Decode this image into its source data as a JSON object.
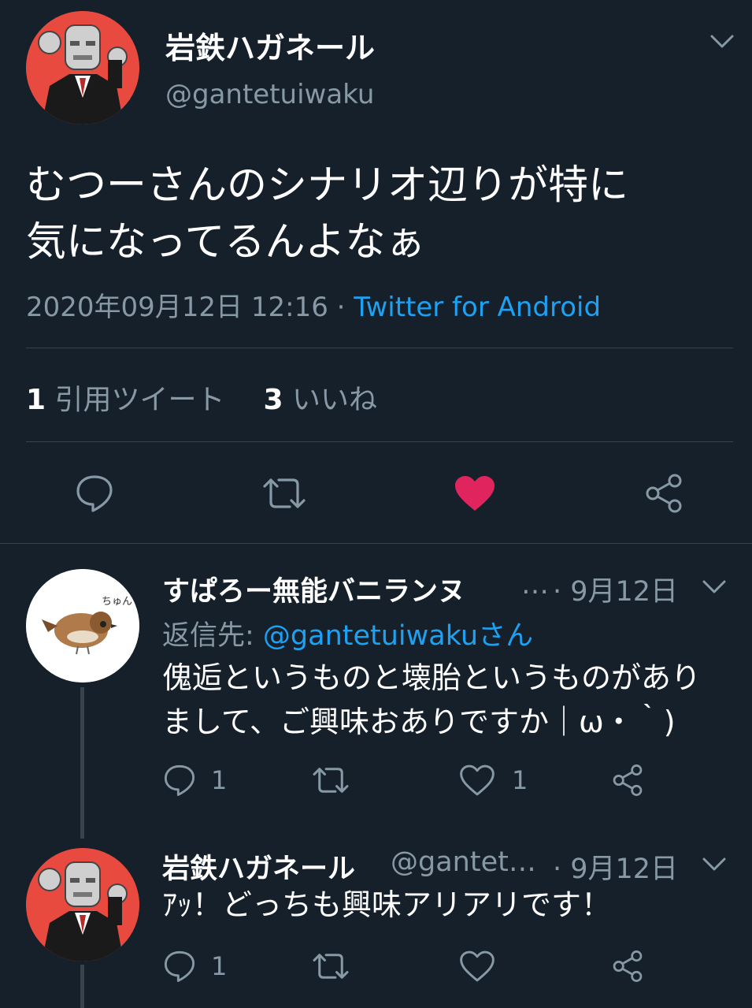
{
  "main_tweet": {
    "display_name": "岩鉄ハガネール",
    "handle": "@gantetuiwaku",
    "text_line1": "むつーさんのシナリオ辺りが特に",
    "text_line2": "気になってるんよなぁ",
    "timestamp": "2020年09月12日 12:16",
    "separator": " · ",
    "source": "Twitter for Android",
    "quote_count": "1",
    "quote_label": "引用ツイート",
    "like_count": "3",
    "like_label": "いいね",
    "liked": true,
    "like_color": "#e0245e"
  },
  "replies": [
    {
      "display_name": "すぱろー無能バニランヌ",
      "ellipsis": "…",
      "date": "· 9月12日",
      "reply_to_label": "返信先: ",
      "reply_to_handle": "@gantetuiwakuさん",
      "text_line1": "傀逅というものと壊胎というものがあり",
      "text_line2": "まして、ご興味おありですか｜ω・｀)",
      "reply_count": "1",
      "like_count": "1",
      "avatar_text": "ちゅん"
    },
    {
      "display_name": "岩鉄ハガネール",
      "handle": "@gantet…",
      "date": "· 9月12日",
      "text_line1": "ｱｯ！どっちも興味アリアリです！",
      "reply_count": "1"
    }
  ],
  "icons": {
    "chevron": "chevron-down-icon",
    "reply": "reply-icon",
    "retweet": "retweet-icon",
    "like": "heart-icon",
    "share": "share-icon"
  },
  "colors": {
    "background": "#15202b",
    "accent": "#1da1f2",
    "secondary_text": "#8899a6",
    "avatar_bg": "#e84a3f"
  }
}
